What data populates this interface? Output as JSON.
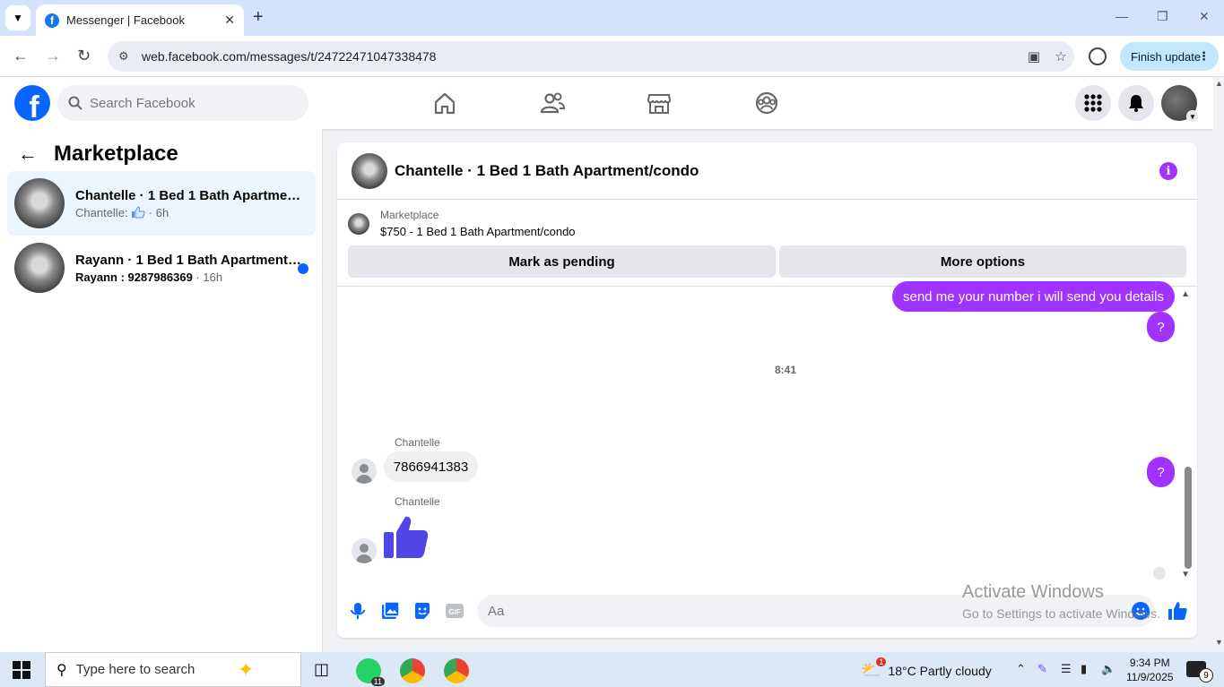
{
  "browser": {
    "tab_title": "Messenger | Facebook",
    "url": "web.facebook.com/messages/t/24722471047338478",
    "finish_update": "Finish update"
  },
  "fb": {
    "search_placeholder": "Search Facebook"
  },
  "sidebar": {
    "title": "Marketplace",
    "conversations": [
      {
        "name": "Chantelle · 1 Bed 1 Bath Apartment/condo",
        "preview_sender": "Chantelle:",
        "time": " · 6h",
        "active": true,
        "unread": false
      },
      {
        "name": "Rayann · 1 Bed 1 Bath Apartment/condo",
        "preview_sender": "Rayann : 9287986369",
        "time": " · 16h",
        "active": false,
        "unread": true
      }
    ]
  },
  "chat": {
    "title": "Chantelle · 1 Bed 1 Bath Apartment/condo",
    "listing_label": "Marketplace",
    "listing_title": "$750 - 1 Bed 1 Bath Apartment/condo",
    "mark_pending": "Mark as pending",
    "more_options": "More options",
    "messages": {
      "out1": "send me your number i will send you details",
      "out2": "?",
      "timestamp": "8:41",
      "out3": "?",
      "sender1": "Chantelle",
      "in1": "7866941383",
      "sender2": "Chantelle"
    },
    "composer_placeholder": "Aa"
  },
  "watermark": {
    "line1": "Activate Windows",
    "line2": "Go to Settings to activate Windows."
  },
  "taskbar": {
    "search_placeholder": "Type here to search",
    "whatsapp_badge": "11",
    "weather_badge": "1",
    "weather": "18°C  Partly cloudy",
    "time": "9:34 PM",
    "date": "11/9/2025",
    "notifications": "9"
  },
  "colors": {
    "brand": "#0866ff",
    "accent": "#a033ff",
    "active_conv": "#ebf5ff"
  }
}
